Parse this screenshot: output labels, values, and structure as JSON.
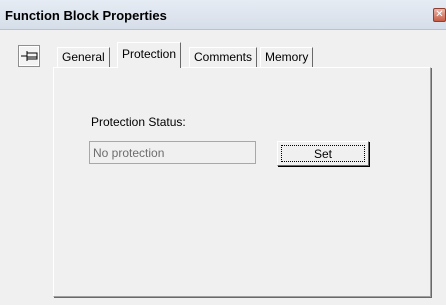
{
  "window": {
    "title": "Function Block Properties",
    "close_icon": "close-icon"
  },
  "toolbar": {
    "pin_icon": "pin-icon"
  },
  "tabs": [
    {
      "label": "General",
      "active": false
    },
    {
      "label": "Protection",
      "active": true
    },
    {
      "label": "Comments",
      "active": false
    },
    {
      "label": "Memory",
      "active": false
    }
  ],
  "protection": {
    "status_label": "Protection Status:",
    "status_value": "No protection",
    "set_button_label": "Set"
  }
}
